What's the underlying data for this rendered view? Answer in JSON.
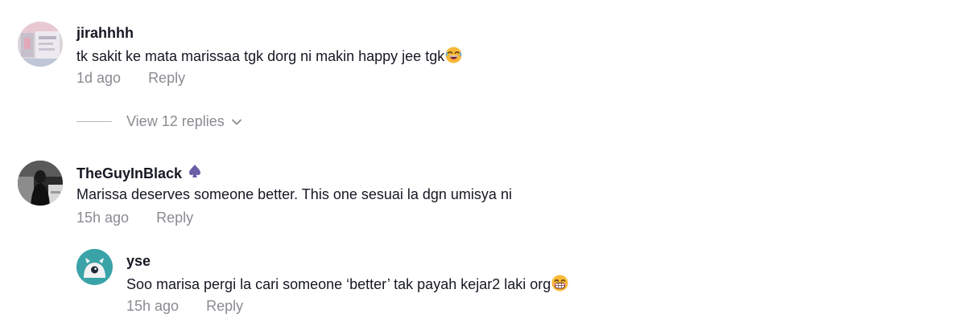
{
  "comments": [
    {
      "username": "jirahhhh",
      "text": "tk sakit ke mata marissaa tgk dorg ni makin happy jee tgk",
      "emoji_icon": "laughing-face-emoji-icon",
      "time": "1d ago",
      "reply_label": "Reply",
      "view_replies_label": "View 12 replies"
    },
    {
      "username": "TheGuyInBlack",
      "badge_icon": "spade-icon",
      "badge_color": "#6b5ea8",
      "text": "Marissa deserves someone better. This one sesuai la dgn umisya ni",
      "time": "15h ago",
      "reply_label": "Reply",
      "replies": [
        {
          "username": "yse",
          "text": "Soo marisa pergi la cari someone ‘better’ tak payah kejar2 laki org",
          "emoji_icon": "grinning-face-emoji-icon",
          "time": "15h ago",
          "reply_label": "Reply"
        }
      ]
    }
  ],
  "colors": {
    "text_primary": "#161823",
    "text_secondary": "#8a8b91",
    "avatar_teal": "#3aa3a8"
  }
}
